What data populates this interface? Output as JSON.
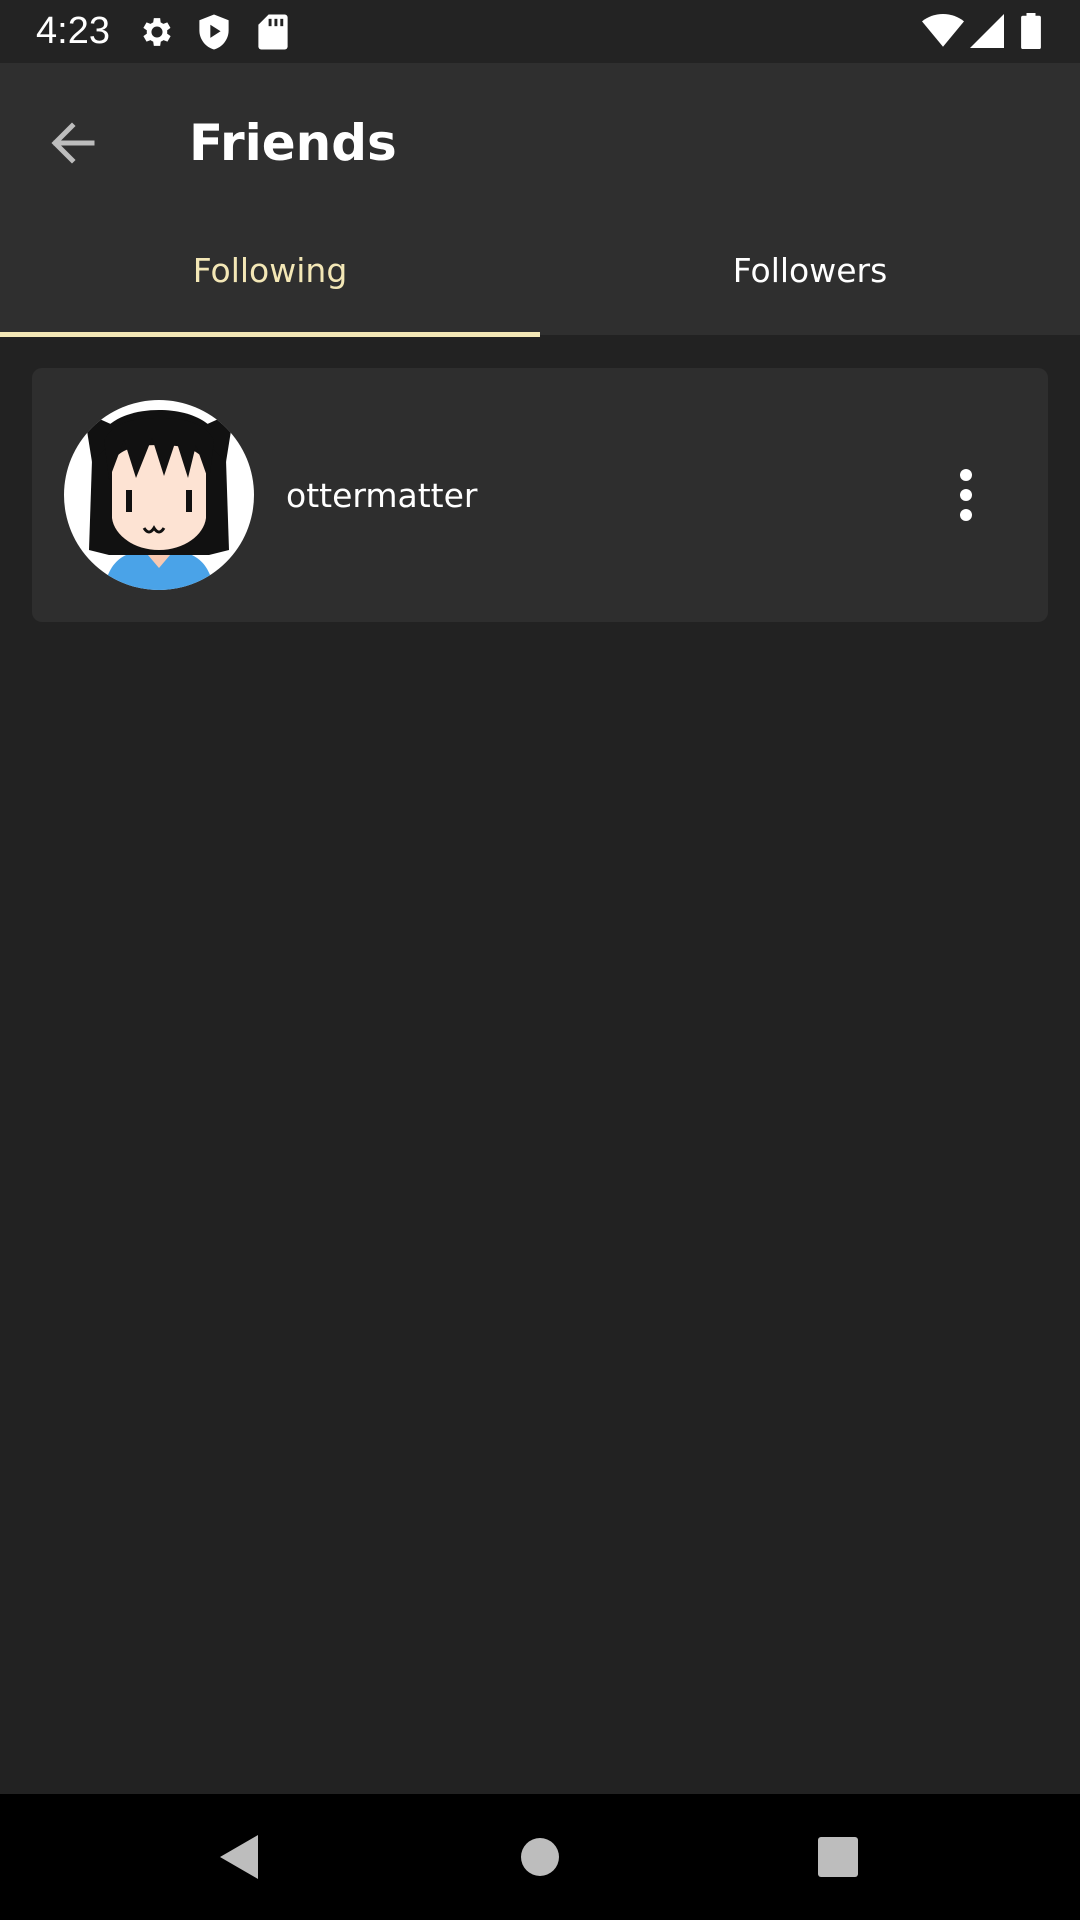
{
  "status_bar": {
    "time": "4:23",
    "left_icons": [
      "settings-icon",
      "shield-play-icon",
      "sd-card-icon"
    ],
    "right_icons": [
      "wifi-icon",
      "signal-icon",
      "battery-icon"
    ]
  },
  "app_bar": {
    "back_icon": "arrow-back-icon",
    "title": "Friends"
  },
  "tabs": [
    {
      "label": "Following",
      "active": true
    },
    {
      "label": "Followers",
      "active": false
    }
  ],
  "users": [
    {
      "username": "ottermatter",
      "avatar": "anime-girl-avatar",
      "menu_icon": "more-vert-icon"
    }
  ],
  "nav_bar": {
    "icons": [
      "nav-back-icon",
      "nav-home-icon",
      "nav-recents-icon"
    ]
  },
  "colors": {
    "background": "#222222",
    "app_bar": "#2f2f2f",
    "card": "#2e2e2e",
    "accent": "#f3e7b6",
    "text": "#ffffff"
  }
}
